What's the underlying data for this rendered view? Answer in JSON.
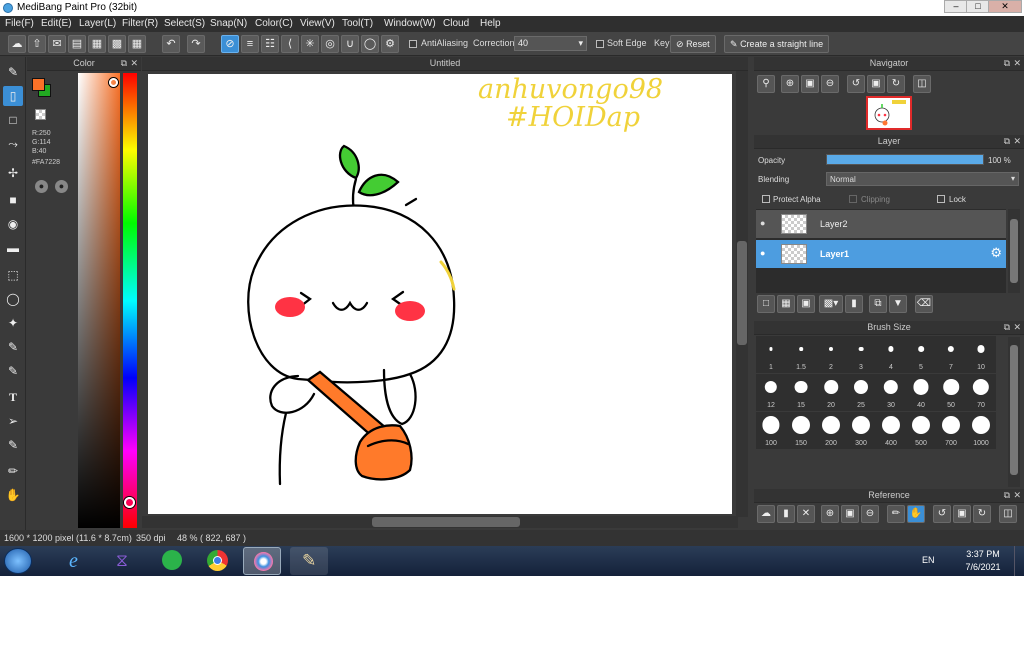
{
  "window": {
    "title": "MediBang Paint Pro (32bit)",
    "min": "–",
    "max": "□",
    "close": "✕"
  },
  "menu": [
    "File(F)",
    "Edit(E)",
    "Layer(L)",
    "Filter(R)",
    "Select(S)",
    "Snap(N)",
    "Color(C)",
    "View(V)",
    "Tool(T)",
    "Window(W)",
    "Cloud",
    "Help"
  ],
  "toolbar": {
    "antialiasing_label": "AntiAliasing",
    "antialiasing_checked": true,
    "correction_label": "Correction",
    "correction_value": "40",
    "soft_edge_label": "Soft Edge",
    "key_label": "Key",
    "reset_label": "Reset",
    "straight_line_label": "Create a straight line"
  },
  "color_panel": {
    "title": "Color",
    "r": "R:250",
    "g": "G:114",
    "b": "B:40",
    "hex": "#FA7228",
    "fg_color": "#FA7228",
    "bg_color": "#22AA22"
  },
  "canvas": {
    "title": "Untitled",
    "handwriting_line1": "anhuvongo98",
    "handwriting_line2": "#HOIDap"
  },
  "navigator": {
    "title": "Navigator"
  },
  "layer_panel": {
    "title": "Layer",
    "opacity_label": "Opacity",
    "opacity_value": "100 %",
    "opacity": 1.0,
    "blending_label": "Blending",
    "blending_value": "Normal",
    "protect_alpha_label": "Protect Alpha",
    "clipping_label": "Clipping",
    "lock_label": "Lock",
    "layers": [
      {
        "name": "Layer2",
        "selected": false
      },
      {
        "name": "Layer1",
        "selected": true
      }
    ]
  },
  "brush_size": {
    "title": "Brush Size",
    "sizes": [
      "1",
      "1.5",
      "2",
      "3",
      "4",
      "5",
      "7",
      "10",
      "12",
      "15",
      "20",
      "25",
      "30",
      "40",
      "50",
      "70",
      "100",
      "150",
      "200",
      "300",
      "400",
      "500",
      "700",
      "1000"
    ]
  },
  "reference": {
    "title": "Reference"
  },
  "status": {
    "size": "1600 * 1200 pixel",
    "physical": "(11.6 * 8.7cm)",
    "dpi": "350 dpi",
    "zoom": "48 %",
    "coords": "( 822, 687 )"
  },
  "taskbar": {
    "lang": "EN",
    "time": "3:37 PM",
    "date": "7/6/2021"
  }
}
